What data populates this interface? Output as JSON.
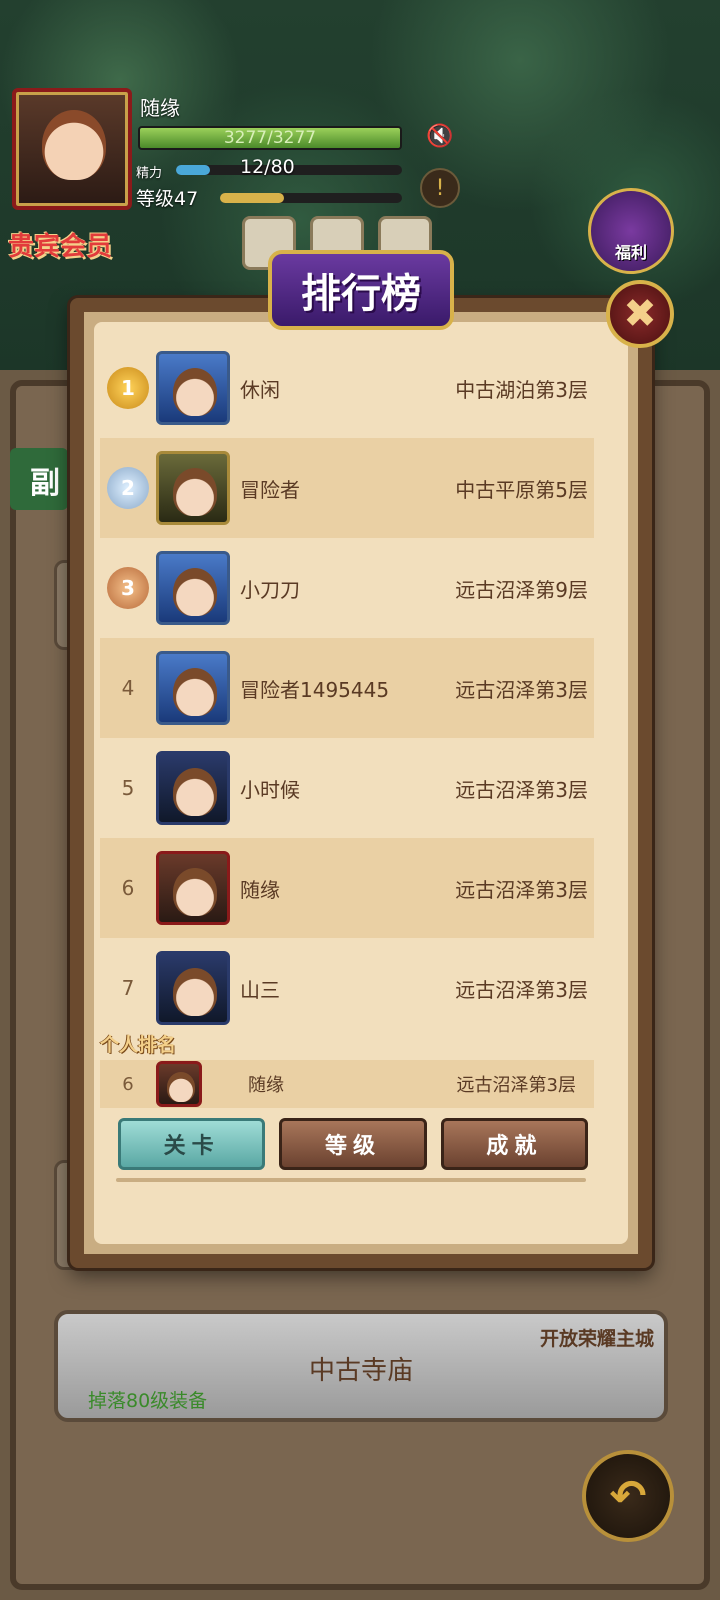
{
  "player": {
    "name": "随缘",
    "hp_text": "3277/3277",
    "hp_fraction": 1.0,
    "stamina_label": "精力",
    "stamina_text": "12/80",
    "stamina_fraction": 0.15,
    "level_text": "等级47",
    "level_fraction": 0.35,
    "vip_label": "贵宾会员"
  },
  "top_bar": {
    "welfare_label": "福利"
  },
  "background": {
    "side_tab_label": "副"
  },
  "modal": {
    "title": "排行榜",
    "close_icon": "✖",
    "rows": [
      {
        "rank": "1",
        "name": "休闲",
        "stage": "中古湖泊第3层",
        "medal": "gold"
      },
      {
        "rank": "2",
        "name": "冒险者",
        "stage": "中古平原第5层",
        "medal": "silver"
      },
      {
        "rank": "3",
        "name": "小刀刀",
        "stage": "远古沼泽第9层",
        "medal": "bronze"
      },
      {
        "rank": "4",
        "name": "冒险者1495445",
        "stage": "远古沼泽第3层"
      },
      {
        "rank": "5",
        "name": "小时候",
        "stage": "远古沼泽第3层"
      },
      {
        "rank": "6",
        "name": "随缘",
        "stage": "远古沼泽第3层"
      },
      {
        "rank": "7",
        "name": "山三",
        "stage": "远古沼泽第3层"
      }
    ],
    "personal_title": "个人排名",
    "personal": {
      "rank": "6",
      "name": "随缘",
      "stage": "远古沼泽第3层"
    },
    "tabs": [
      {
        "label": "关卡",
        "active": true
      },
      {
        "label": "等级",
        "active": false
      },
      {
        "label": "成就",
        "active": false
      }
    ]
  },
  "stage_card": {
    "name": "中古寺庙",
    "unlock_text": "开放荣耀主城",
    "drop_text": "掉落80级装备"
  },
  "colors": {
    "modal_bg": "#f2dfbd",
    "alt_row": "#ead0a4",
    "title_purple": "#6a3aa0",
    "active_tab": "#5aa8a4",
    "inactive_tab": "#6b4230"
  }
}
